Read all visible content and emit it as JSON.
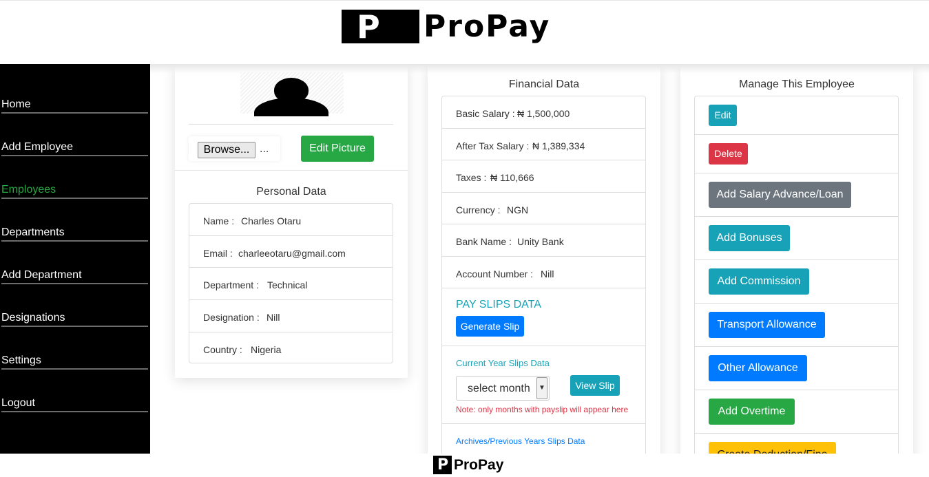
{
  "brand": {
    "logo_letter": "P",
    "name": "ProPay"
  },
  "sidebar": {
    "items": [
      {
        "label": "Home",
        "active": false
      },
      {
        "label": "Add Employee",
        "active": false
      },
      {
        "label": "Employees",
        "active": true
      },
      {
        "label": "Departments",
        "active": false
      },
      {
        "label": "Add Department",
        "active": false
      },
      {
        "label": "Designations",
        "active": false
      },
      {
        "label": "Settings",
        "active": false
      },
      {
        "label": "Logout",
        "active": false
      }
    ]
  },
  "profile": {
    "browse_label": "Browse...",
    "file_placeholder": "...",
    "edit_picture_label": "Edit Picture"
  },
  "personal": {
    "title": "Personal Data",
    "rows": [
      {
        "label": "Name :",
        "value": "Charles Otaru"
      },
      {
        "label": "Email :",
        "value": "charleeotaru@gmail.com"
      },
      {
        "label": "Department :",
        "value": "Technical"
      },
      {
        "label": "Designation :",
        "value": "Nill"
      },
      {
        "label": "Country :",
        "value": "Nigeria"
      }
    ]
  },
  "financial": {
    "title": "Financial Data",
    "rows": [
      {
        "label": "Basic Salary :",
        "value": "₦ 1,500,000"
      },
      {
        "label": "After Tax Salary :",
        "value": "₦ 1,389,334"
      },
      {
        "label": "Taxes :",
        "value": "₦ 110,666"
      },
      {
        "label": "Currency :",
        "value": "NGN"
      },
      {
        "label": "Bank Name :",
        "value": "Unity Bank"
      },
      {
        "label": "Account Number :",
        "value": "Nill"
      }
    ],
    "payslips_heading": "PAY SLIPS DATA",
    "generate_slip_label": "Generate Slip",
    "current_year_label": "Current Year Slips Data",
    "month_select_value": "select month",
    "view_slip_label": "View Slip",
    "note": "Note: only months with payslip will appear here",
    "archive_label": "Archives/Previous Years Slips Data"
  },
  "manage": {
    "title": "Manage This Employee",
    "actions": [
      {
        "label": "Edit",
        "color": "#17a2b8"
      },
      {
        "label": "Delete",
        "color": "#dc3545"
      },
      {
        "label": "Add Salary Advance/Loan",
        "color": "#6c757d"
      },
      {
        "label": "Add Bonuses",
        "color": "#17a2b8"
      },
      {
        "label": "Add Commission",
        "color": "#17a2b8"
      },
      {
        "label": "Transport Allowance",
        "color": "#007bff"
      },
      {
        "label": "Other Allowance",
        "color": "#007bff"
      },
      {
        "label": "Add Overtime",
        "color": "#28a745"
      },
      {
        "label": "Create Deduction/Fine",
        "color": "#ffc107"
      }
    ]
  }
}
